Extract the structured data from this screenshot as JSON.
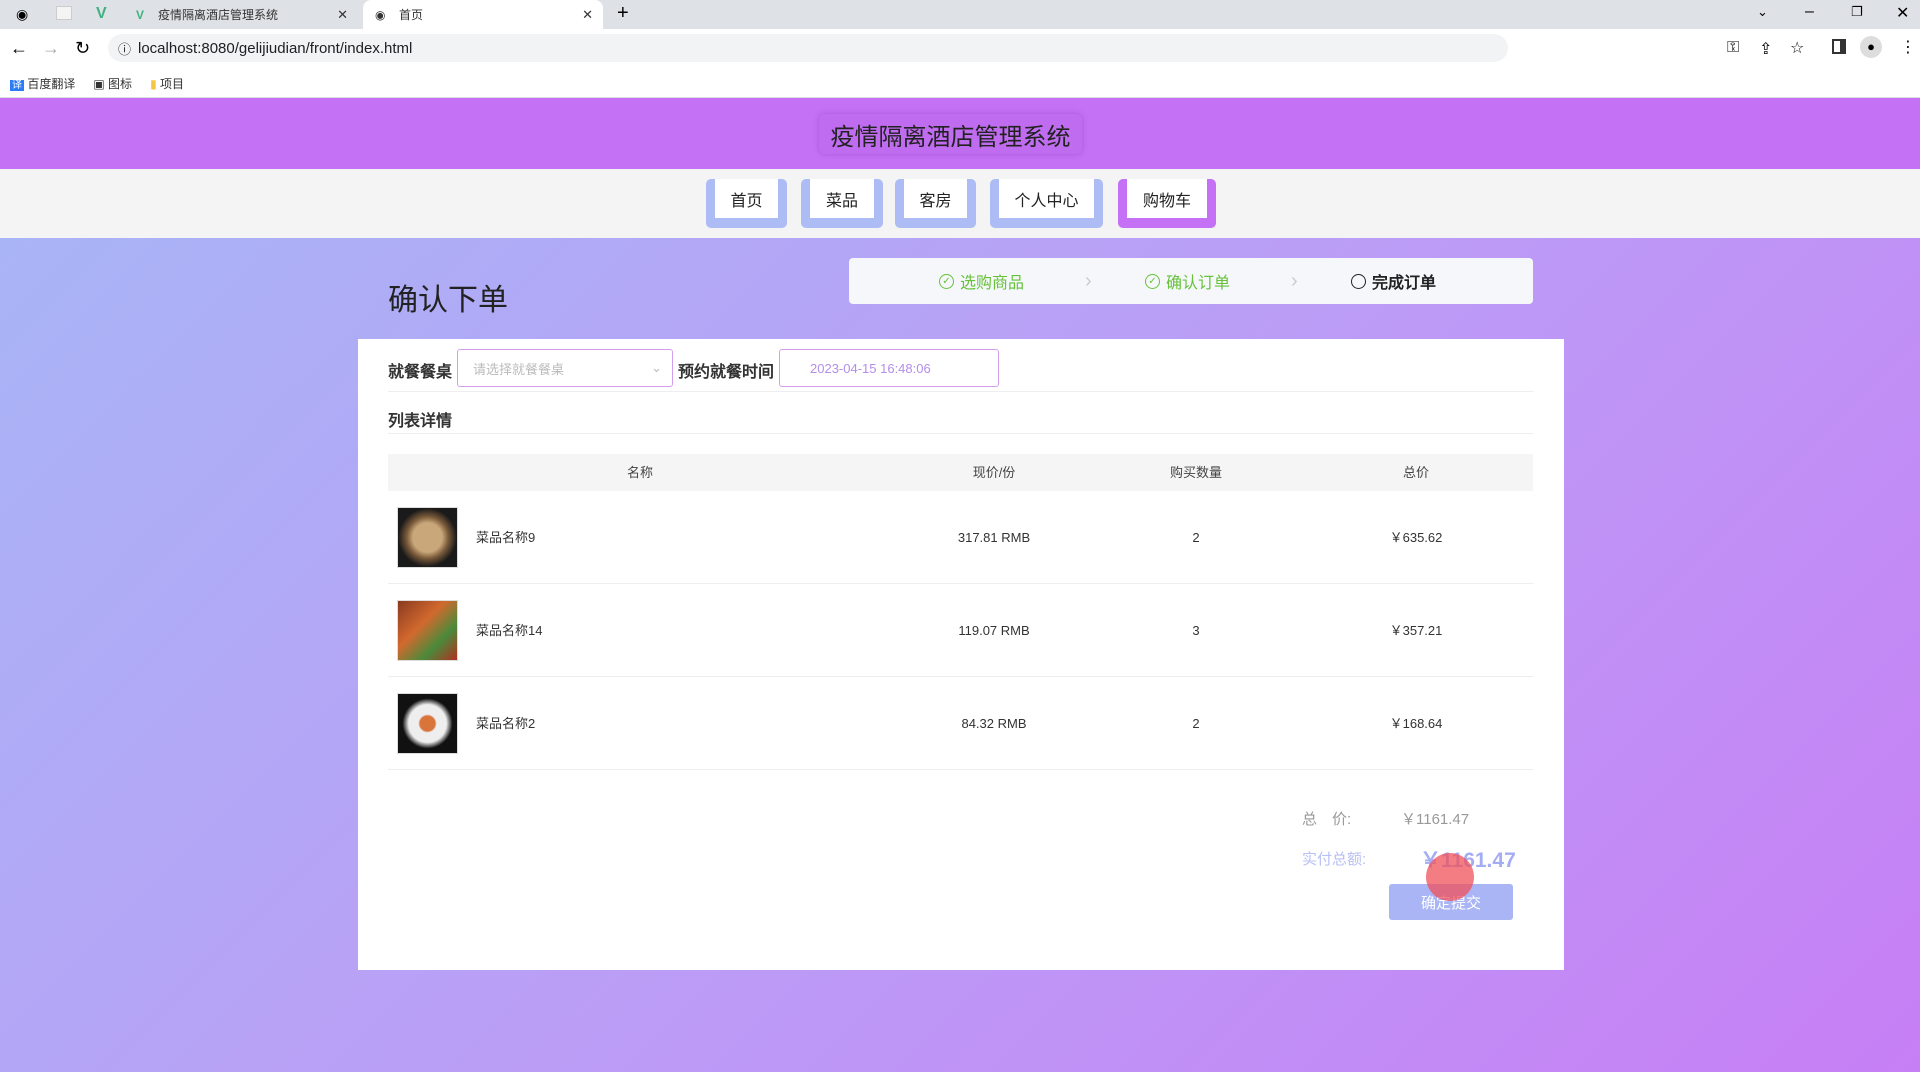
{
  "browser": {
    "tabs": [
      {
        "title": "疫情隔离酒店管理系统"
      },
      {
        "title": "首页"
      }
    ],
    "url": "localhost:8080/gelijiudian/front/index.html",
    "bookmarks": [
      "百度翻译",
      "图标",
      "项目"
    ]
  },
  "site": {
    "title": "疫情隔离酒店管理系统"
  },
  "nav": [
    {
      "label": "首页"
    },
    {
      "label": "菜品"
    },
    {
      "label": "客房"
    },
    {
      "label": "个人中心"
    },
    {
      "label": "购物车"
    }
  ],
  "page": {
    "heading": "确认下单",
    "steps": [
      {
        "label": "选购商品",
        "status": "done"
      },
      {
        "label": "确认订单",
        "status": "done"
      },
      {
        "label": "完成订单",
        "status": "current"
      }
    ]
  },
  "form": {
    "table_label": "就餐餐桌",
    "table_placeholder": "请选择就餐餐桌",
    "time_label": "预约就餐时间",
    "time_value": "2023-04-15 16:48:06"
  },
  "list": {
    "title": "列表详情",
    "headers": [
      "名称",
      "现价/份",
      "购买数量",
      "总价"
    ],
    "rows": [
      {
        "name": "菜品名称9",
        "price": "317.81 RMB",
        "qty": "2",
        "total": "￥635.62"
      },
      {
        "name": "菜品名称14",
        "price": "119.07 RMB",
        "qty": "3",
        "total": "￥357.21"
      },
      {
        "name": "菜品名称2",
        "price": "84.32 RMB",
        "qty": "2",
        "total": "￥168.64"
      }
    ]
  },
  "summary": {
    "total_label": "总　价:",
    "total_value": "￥1161.47",
    "paid_label": "实付总额:",
    "paid_value": "￥1161.47",
    "submit": "确定提交"
  },
  "colors": {
    "header": "#c471f5",
    "nav_button": "#aebcf5",
    "step_done": "#67c23a",
    "accent": "#a4acf4"
  }
}
